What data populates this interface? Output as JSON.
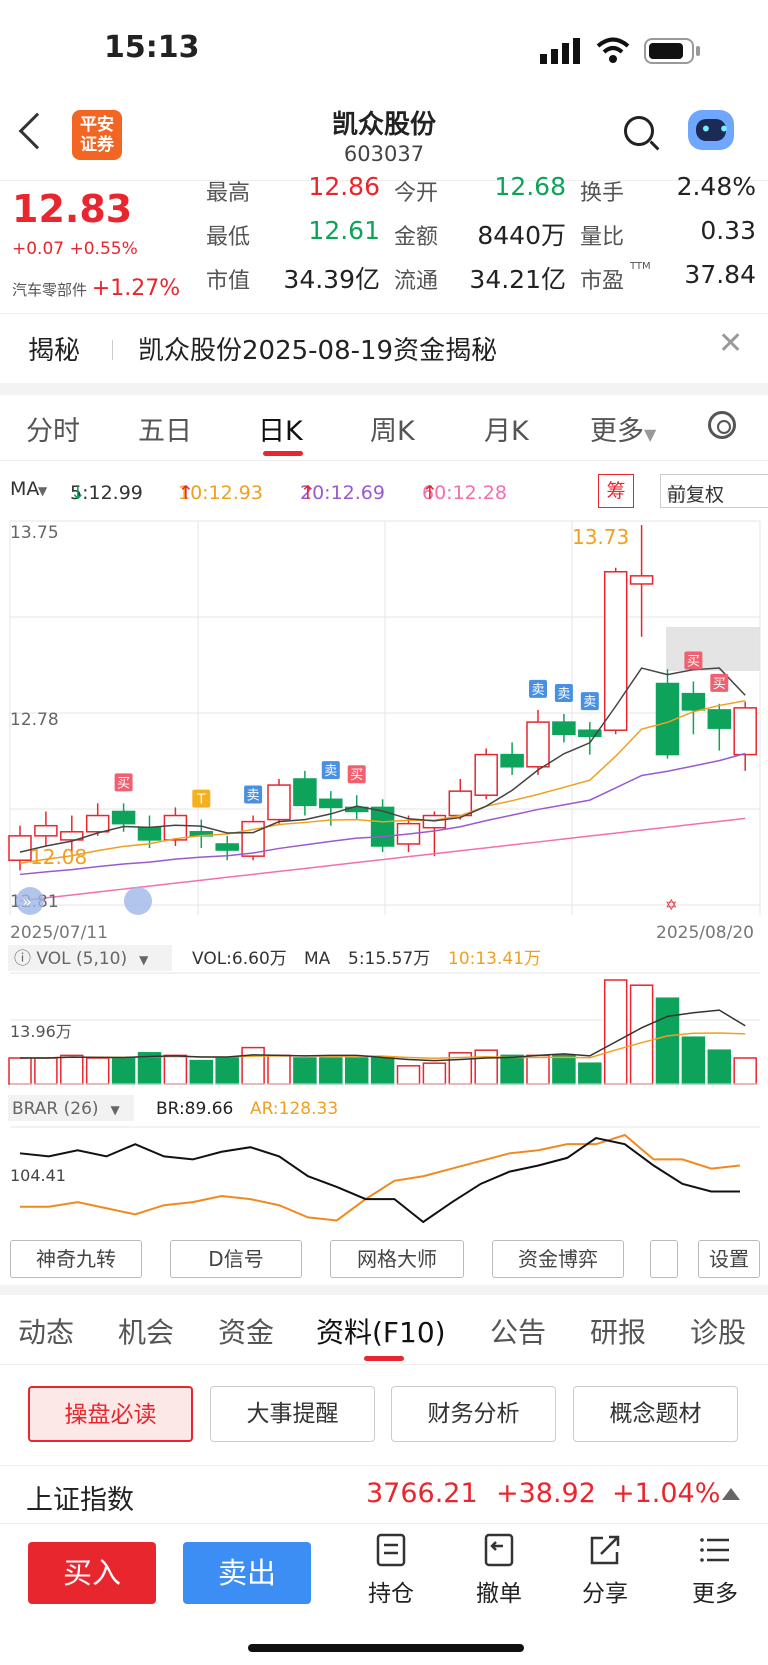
{
  "status": {
    "time": "15:13"
  },
  "header": {
    "title": "凯众股份",
    "code": "603037",
    "logo_line1": "平安",
    "logo_line2": "证券"
  },
  "quote": {
    "price": "12.83",
    "change": "+0.07 +0.55%",
    "sector_name": "汽车零部件",
    "sector_change": "+1.27%",
    "items": [
      {
        "label": "最高",
        "value": "12.86"
      },
      {
        "label": "今开",
        "value": "12.68"
      },
      {
        "label": "换手",
        "value": "2.48%"
      },
      {
        "label": "最低",
        "value": "12.61"
      },
      {
        "label": "金额",
        "value": "8440万"
      },
      {
        "label": "量比",
        "value": "0.33"
      },
      {
        "label": "市值",
        "value": "34.39亿"
      },
      {
        "label": "流通",
        "value": "34.21亿"
      },
      {
        "label": "市盈",
        "value": "37.84",
        "sup": "TTM"
      }
    ]
  },
  "reveal": {
    "tag": "揭秘",
    "text": "凯众股份2025-08-19资金揭秘"
  },
  "period_tabs": [
    "分时",
    "五日",
    "日K",
    "周K",
    "月K",
    "更多"
  ],
  "ma_row": {
    "label": "MA",
    "ma5": "5:12.99",
    "ma10": "10:12.93",
    "ma20": "20:12.69",
    "ma60": "60:12.28",
    "chou": "筹",
    "fuquan": "前复权"
  },
  "colors": {
    "up": "#e8262d",
    "down": "#0ea35a",
    "ma5": "#444444",
    "ma10": "#f0a020",
    "ma20": "#9b59d0",
    "ma60": "#f070b0",
    "blue": "#3c8ef5"
  },
  "chart_data": {
    "type": "candlestick",
    "y_top_label": "13.75",
    "y_mid_label": "12.78",
    "y_bottom_label": "12.81",
    "ylim": [
      11.83,
      13.75
    ],
    "x_start": "2025/07/11",
    "x_end": "2025/08/20",
    "high_label": "13.73",
    "low_label": "12.08",
    "candles": [
      {
        "o": 12.08,
        "c": 12.2,
        "h": 12.25,
        "l": 12.03
      },
      {
        "o": 12.2,
        "c": 12.25,
        "h": 12.32,
        "l": 12.15
      },
      {
        "o": 12.18,
        "c": 12.22,
        "h": 12.3,
        "l": 12.12
      },
      {
        "o": 12.22,
        "c": 12.3,
        "h": 12.36,
        "l": 12.2
      },
      {
        "o": 12.32,
        "c": 12.26,
        "h": 12.36,
        "l": 12.22
      },
      {
        "o": 12.24,
        "c": 12.18,
        "h": 12.3,
        "l": 12.14
      },
      {
        "o": 12.18,
        "c": 12.3,
        "h": 12.34,
        "l": 12.15
      },
      {
        "o": 12.22,
        "c": 12.2,
        "h": 12.28,
        "l": 12.14
      },
      {
        "o": 12.16,
        "c": 12.13,
        "h": 12.2,
        "l": 12.08
      },
      {
        "o": 12.1,
        "c": 12.27,
        "h": 12.3,
        "l": 12.08
      },
      {
        "o": 12.28,
        "c": 12.45,
        "h": 12.48,
        "l": 12.26
      },
      {
        "o": 12.48,
        "c": 12.35,
        "h": 12.52,
        "l": 12.3
      },
      {
        "o": 12.38,
        "c": 12.34,
        "h": 12.42,
        "l": 12.25
      },
      {
        "o": 12.34,
        "c": 12.32,
        "h": 12.4,
        "l": 12.28
      },
      {
        "o": 12.34,
        "c": 12.15,
        "h": 12.38,
        "l": 12.12
      },
      {
        "o": 12.16,
        "c": 12.26,
        "h": 12.3,
        "l": 12.12
      },
      {
        "o": 12.24,
        "c": 12.3,
        "h": 12.32,
        "l": 12.1
      },
      {
        "o": 12.3,
        "c": 12.42,
        "h": 12.48,
        "l": 12.28
      },
      {
        "o": 12.4,
        "c": 12.6,
        "h": 12.63,
        "l": 12.38
      },
      {
        "o": 12.6,
        "c": 12.54,
        "h": 12.66,
        "l": 12.5
      },
      {
        "o": 12.54,
        "c": 12.76,
        "h": 12.82,
        "l": 12.5
      },
      {
        "o": 12.76,
        "c": 12.7,
        "h": 12.8,
        "l": 12.66
      },
      {
        "o": 12.72,
        "c": 12.69,
        "h": 12.76,
        "l": 12.6
      },
      {
        "o": 12.72,
        "c": 13.5,
        "h": 13.52,
        "l": 12.7
      },
      {
        "o": 13.44,
        "c": 13.48,
        "h": 13.73,
        "l": 13.18
      },
      {
        "o": 12.95,
        "c": 12.6,
        "h": 13.02,
        "l": 12.58
      },
      {
        "o": 12.9,
        "c": 12.82,
        "h": 12.96,
        "l": 12.7
      },
      {
        "o": 12.82,
        "c": 12.73,
        "h": 12.85,
        "l": 12.62
      },
      {
        "o": 12.6,
        "c": 12.83,
        "h": 12.86,
        "l": 12.52
      }
    ],
    "signals": [
      {
        "i": 4,
        "text": "买",
        "kind": "buy"
      },
      {
        "i": 7,
        "text": "T",
        "kind": "t"
      },
      {
        "i": 9,
        "text": "卖",
        "kind": "sell"
      },
      {
        "i": 12,
        "text": "卖",
        "kind": "sell"
      },
      {
        "i": 13,
        "text": "买",
        "kind": "buy"
      },
      {
        "i": 20,
        "text": "卖",
        "kind": "sell"
      },
      {
        "i": 21,
        "text": "卖",
        "kind": "sell"
      },
      {
        "i": 22,
        "text": "卖",
        "kind": "sell"
      },
      {
        "i": 26,
        "text": "买",
        "kind": "buy"
      },
      {
        "i": 27,
        "text": "买",
        "kind": "buy"
      }
    ],
    "volume": {
      "header": "VOL (5,10)",
      "vol": "VOL:6.60万",
      "ma_label": "MA",
      "ma5": "5:15.57万",
      "ma10": "10:13.41万",
      "y_label": "13.96万",
      "values": [
        10,
        10,
        11,
        10,
        10,
        12,
        11,
        9,
        10,
        14,
        11,
        10,
        10,
        10,
        10,
        7,
        8,
        12,
        13,
        11,
        11,
        11,
        8,
        40,
        38,
        33,
        18,
        13,
        10
      ]
    },
    "brar": {
      "header": "BRAR (26)",
      "br": "BR:89.66",
      "ar": "AR:128.33",
      "y_label": "104.41",
      "br_values": [
        130,
        128,
        132,
        128,
        136,
        128,
        126,
        131,
        134,
        128,
        115,
        108,
        100,
        100,
        85,
        98,
        110,
        118,
        122,
        127,
        140,
        136,
        122,
        110,
        105,
        105
      ],
      "ar_values": [
        95,
        95,
        98,
        94,
        90,
        96,
        98,
        102,
        100,
        96,
        88,
        86,
        100,
        112,
        115,
        120,
        125,
        130,
        132,
        136,
        136,
        142,
        126,
        126,
        120,
        122
      ]
    }
  },
  "tool_buttons": [
    "神奇九转",
    "D信号",
    "网格大师",
    "资金博弈",
    "",
    "设置"
  ],
  "f10_tabs": [
    "动态",
    "机会",
    "资金",
    "资料(F10)",
    "公告",
    "研报",
    "诊股"
  ],
  "f10_buttons": [
    "操盘必读",
    "大事提醒",
    "财务分析",
    "概念题材"
  ],
  "index_bar": {
    "name": "上证指数",
    "value": "3766.21",
    "change": "+38.92",
    "pct": "+1.04%"
  },
  "bottom": {
    "buy": "买入",
    "sell": "卖出",
    "items": [
      "持仓",
      "撤单",
      "分享",
      "更多"
    ]
  }
}
